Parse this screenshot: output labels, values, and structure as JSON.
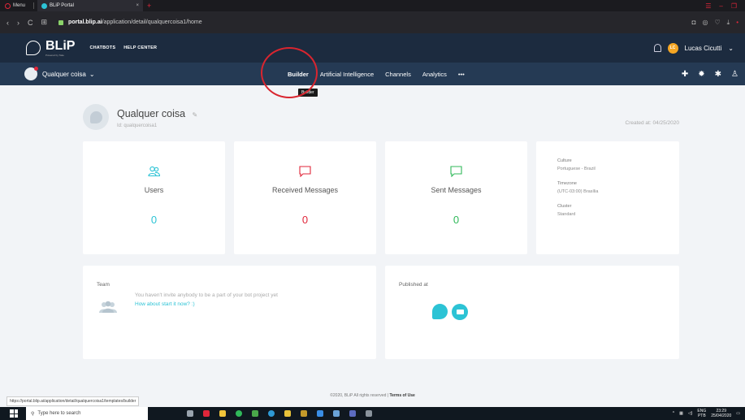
{
  "browser": {
    "menu_label": "Menu",
    "tab_title": "BLiP Portal",
    "tab_close": "×",
    "new_tab": "+",
    "url_host": "portal.blip.ai",
    "url_path": "/application/detail/qualquercoisa1/home"
  },
  "header": {
    "logo": "BLiP",
    "logo_sub": "Powered by Take",
    "links": [
      "CHATBOTS",
      "HELP CENTER"
    ],
    "user_initials": "LC",
    "user_name": "Lucas Cicutti"
  },
  "botnav": {
    "bot_name": "Qualquer coisa",
    "items": [
      "Builder",
      "Artificial Intelligence",
      "Channels",
      "Analytics"
    ],
    "more": "•••",
    "tooltip": "Builder"
  },
  "bot": {
    "name": "Qualquer coisa",
    "id": "Id: qualquercoisa1",
    "created": "Created at: 04/25/2020"
  },
  "stats": [
    {
      "label": "Users",
      "value": "0",
      "color": "#2cc3d5"
    },
    {
      "label": "Received Messages",
      "value": "0",
      "color": "#e0263a"
    },
    {
      "label": "Sent Messages",
      "value": "0",
      "color": "#30b95a"
    }
  ],
  "info": {
    "culture_label": "Culture",
    "culture_value": "Portuguese - Brazil",
    "timezone_label": "Timezone",
    "timezone_value": "(UTC-03:00) Brasília",
    "cluster_label": "Cluster",
    "cluster_value": "Standard"
  },
  "team": {
    "title": "Team",
    "message": "You haven't invite anybody to be a part of your bot project yet",
    "link": "How about start it now? :)"
  },
  "published": {
    "title": "Published at"
  },
  "footer": {
    "text": "©2020, BLiP All rights reserved | ",
    "terms": "Terms of Use"
  },
  "statusbar": "https://portal.blip.ai/application/detail/qualquercoisa1/templates/builder",
  "taskbar": {
    "search_placeholder": "Type here to search",
    "lang": "ENG",
    "lang_sub": "PTB",
    "time": "23:29",
    "date": "25/04/2020"
  }
}
